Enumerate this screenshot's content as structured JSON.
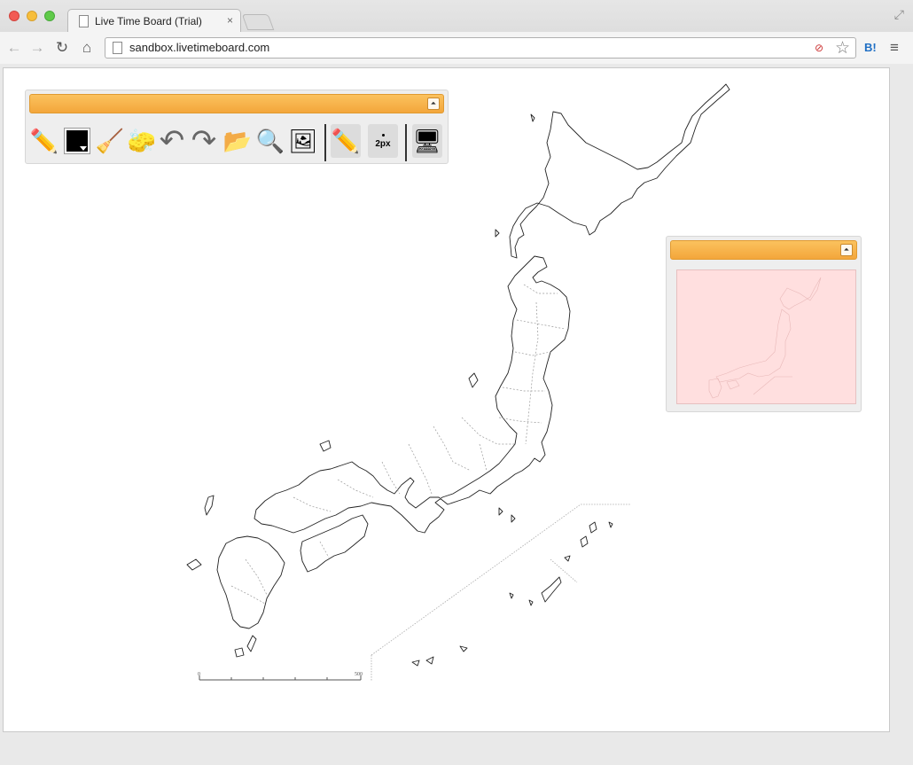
{
  "browser": {
    "tab_title": "Live Time Board (Trial)",
    "tab_close": "×",
    "url": "sandbox.livetimeboard.com",
    "hatena_label": "B!",
    "menu_glyph": "≡",
    "back_glyph": "←",
    "forward_glyph": "→",
    "reload_glyph": "↻",
    "home_glyph": "⌂",
    "star_glyph": "☆",
    "fullscreen_glyph": "⤢"
  },
  "tools": {
    "collapse_glyph": "⏶",
    "items": [
      {
        "name": "pencil",
        "glyph": "✏️"
      },
      {
        "name": "color",
        "glyph": ""
      },
      {
        "name": "broom",
        "glyph": "🧹"
      },
      {
        "name": "eraser",
        "glyph": "🧽"
      },
      {
        "name": "undo",
        "glyph": "↶"
      },
      {
        "name": "redo",
        "glyph": "↷"
      },
      {
        "name": "open-folder",
        "glyph": "📂"
      },
      {
        "name": "zoom",
        "glyph": "🔍"
      },
      {
        "name": "image",
        "glyph": "🖼"
      },
      {
        "name": "pen-mode",
        "glyph": "✏️"
      },
      {
        "name": "export-screen",
        "glyph": "🖥"
      }
    ],
    "stroke_size": "2px",
    "current_color": "#000000"
  },
  "minimap": {
    "collapse_glyph": "⏶",
    "background": "#ffdfdf"
  },
  "map": {
    "scale_start": "0",
    "scale_end": "500"
  }
}
